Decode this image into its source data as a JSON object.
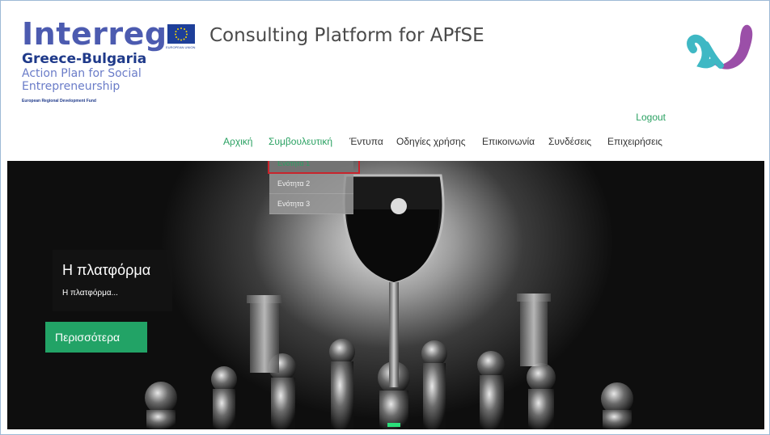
{
  "logo": {
    "main": "Interreg",
    "region": "Greece-Bulgaria",
    "line1": "Action Plan for Social",
    "line2": "Entrepreneurship",
    "fund": "European Regional Development Fund",
    "eu_caption": "EUROPEAN UNION"
  },
  "site_title": "Consulting Platform for APfSE",
  "logout_label": "Logout",
  "nav": {
    "items": [
      {
        "label": "Αρχική",
        "active": true
      },
      {
        "label": "Συμβουλευτική",
        "active": true
      },
      {
        "label": "Έντυπα",
        "active": false
      },
      {
        "label": "Οδηγίες χρήσης",
        "active": false
      },
      {
        "label": "Επικοινωνία",
        "active": false
      },
      {
        "label": "Συνδέσεις",
        "active": false
      },
      {
        "label": "Επιχειρήσεις",
        "active": false
      }
    ]
  },
  "dropdown": {
    "items": [
      {
        "label": "Ενότητα 1",
        "current": true
      },
      {
        "label": "Ενότητα 2",
        "current": false
      },
      {
        "label": "Ενότητα 3",
        "current": false
      }
    ]
  },
  "hero": {
    "title": "Η πλατφόρμα",
    "text": "Η πλατφόρμα...",
    "button_label": "Περισσότερα"
  },
  "colors": {
    "accent": "#2aa162",
    "interreg_blue": "#4c5bb0",
    "highlight": "#c8242c",
    "button": "#22a366"
  },
  "icons": {
    "brand": "platform-logo-icon",
    "eu": "eu-flag-icon"
  }
}
